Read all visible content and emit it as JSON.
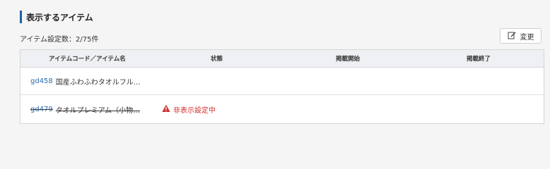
{
  "section": {
    "title": "表示するアイテム"
  },
  "count_text": "アイテム設定数：2/75件",
  "change_button": {
    "label": "変更",
    "icon": "edit-icon"
  },
  "table": {
    "headers": [
      "アイテムコード／アイテム名",
      "状態",
      "掲載開始",
      "掲載終了"
    ],
    "rows": [
      {
        "code": "gd458",
        "name": "国産ふわふわタオルフル…",
        "status": "",
        "start": "",
        "end": ""
      },
      {
        "code": "gd479",
        "name": "タオルプレミアム（小物…",
        "status": "非表示設定中",
        "start": "",
        "end": ""
      }
    ]
  },
  "colors": {
    "accent": "#1f5fa6",
    "link": "#2b6cb0",
    "warning": "#d0312d",
    "header_bg": "#eef0f3"
  }
}
